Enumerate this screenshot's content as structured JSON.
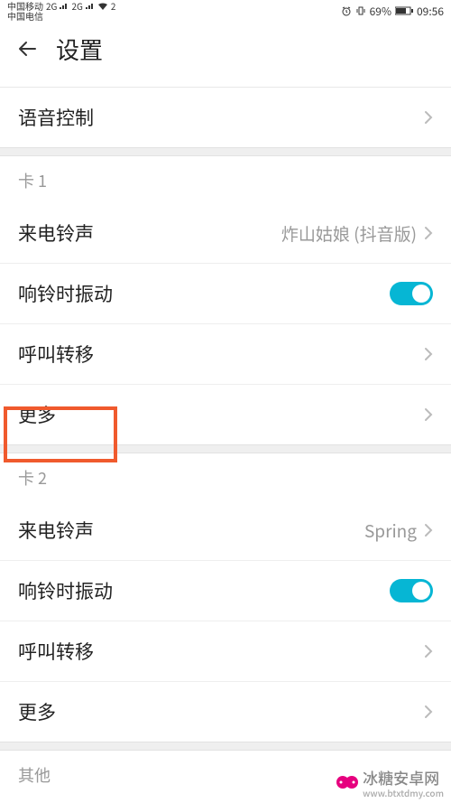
{
  "statusBar": {
    "carrier1": "中国移动",
    "carrier2": "中国电信",
    "netLabel1": "2G",
    "netLabel2": "2G",
    "wifiExp": "2",
    "battery": "69%",
    "time": "09:56"
  },
  "header": {
    "title": "设置"
  },
  "rows": {
    "voice_control": "语音控制"
  },
  "card1": {
    "header": "卡 1",
    "ringtone_label": "来电铃声",
    "ringtone_value": "炸山姑娘 (抖音版)",
    "vibrate_label": "响铃时振动",
    "vibrate_on": true,
    "forward_label": "呼叫转移",
    "more_label": "更多"
  },
  "card2": {
    "header": "卡 2",
    "ringtone_label": "来电铃声",
    "ringtone_value": "Spring",
    "vibrate_label": "响铃时振动",
    "vibrate_on": true,
    "forward_label": "呼叫转移",
    "more_label": "更多"
  },
  "other": {
    "header": "其他"
  },
  "watermark": {
    "text": "冰糖安卓网",
    "sub": "www.btxtdmy.com"
  }
}
